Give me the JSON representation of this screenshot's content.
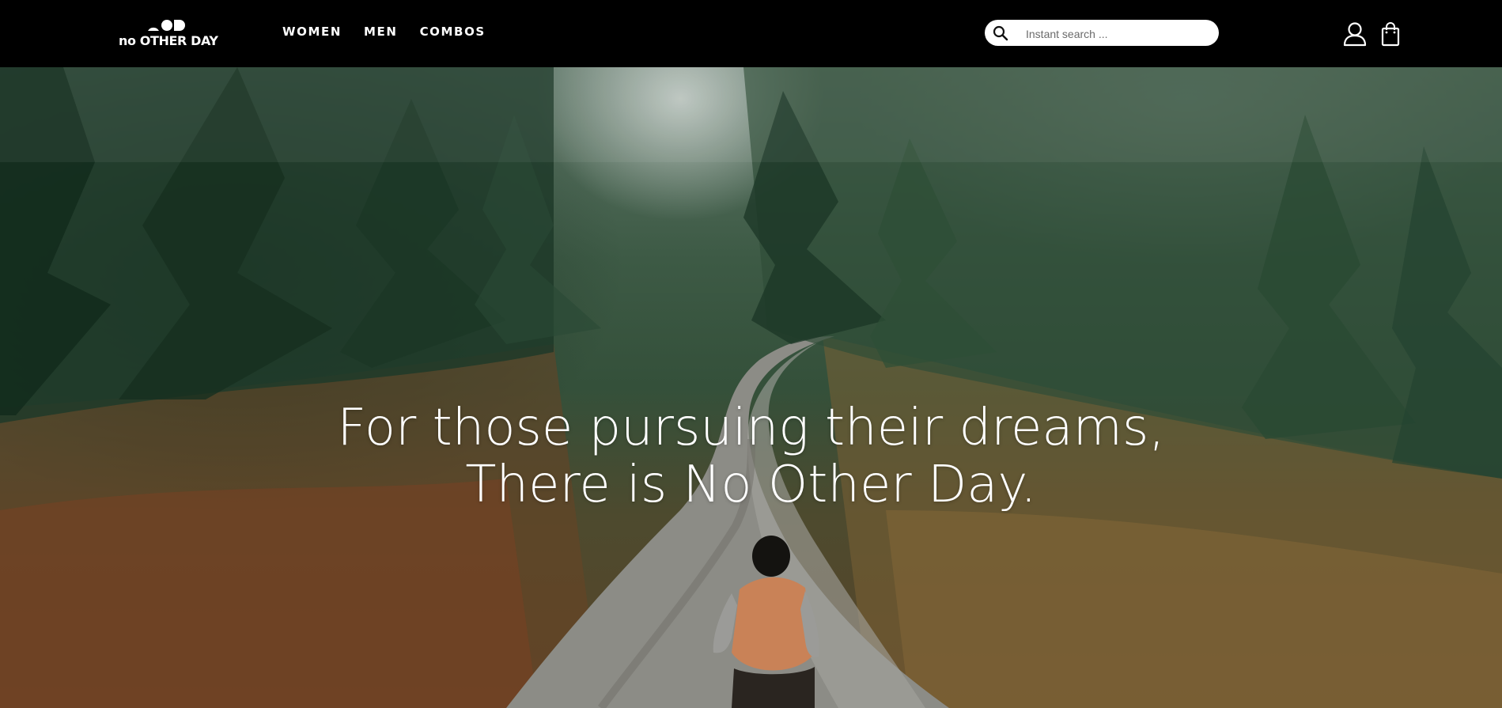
{
  "header": {
    "logo_text": "no OTHER DAY",
    "nav": [
      "WOMEN",
      "MEN",
      "COMBOS"
    ],
    "search": {
      "placeholder": "Instant search ..."
    },
    "icons": [
      "search-icon",
      "account-icon",
      "cart-icon"
    ]
  },
  "hero": {
    "headline_line1": "For those pursuing their dreams,",
    "headline_line2": "There is No Other Day."
  },
  "colors": {
    "header_bg": "#000000",
    "text": "#ffffff",
    "search_bg": "#ffffff"
  }
}
